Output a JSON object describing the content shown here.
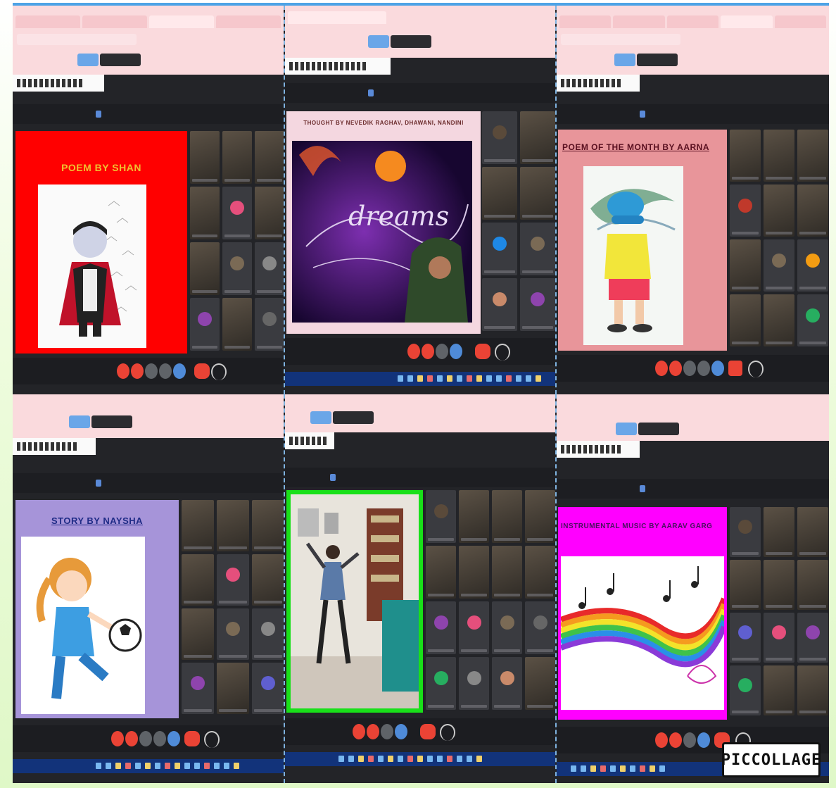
{
  "collage": {
    "watermark": "PICCOLLAGE"
  },
  "panels": [
    {
      "slide_title": "POEM BY SHAN",
      "slide_title_color": "#f0c030",
      "slide_bg": "#ff0000",
      "image": "vampire-cartoon"
    },
    {
      "slide_title": "THOUGHT BY NEVEDIK RAGHAV, DHAWANI, NANDINI",
      "slide_title_color": "#6a2a2a",
      "slide_bg": "#f4d7e0",
      "image": "dreams-night-sky",
      "image_text": "dreams"
    },
    {
      "slide_title": "POEM OF THE MONTH BY AARNA",
      "slide_title_color": "#5a1020",
      "slide_bg": "#e8959a",
      "image": "boy-in-wind"
    },
    {
      "slide_title": "STORY BY NAYSHA",
      "slide_title_color": "#1f2b86",
      "slide_bg": "#a694d9",
      "image": "girl-football"
    },
    {
      "slide_title": "",
      "slide_bg": "#19e019",
      "image": "dance-performance"
    },
    {
      "slide_title": "INSTRUMENTAL MUSIC BY AARAV GARG",
      "slide_title_color": "#4a1060",
      "slide_bg": "#ff00ff",
      "image": "rainbow-music-notes"
    }
  ],
  "colors": {
    "browser_chrome": "#fadadd",
    "meet_dark": "#232428",
    "end_call_red": "#ea4335",
    "accent_blue": "#6aa6e8"
  }
}
